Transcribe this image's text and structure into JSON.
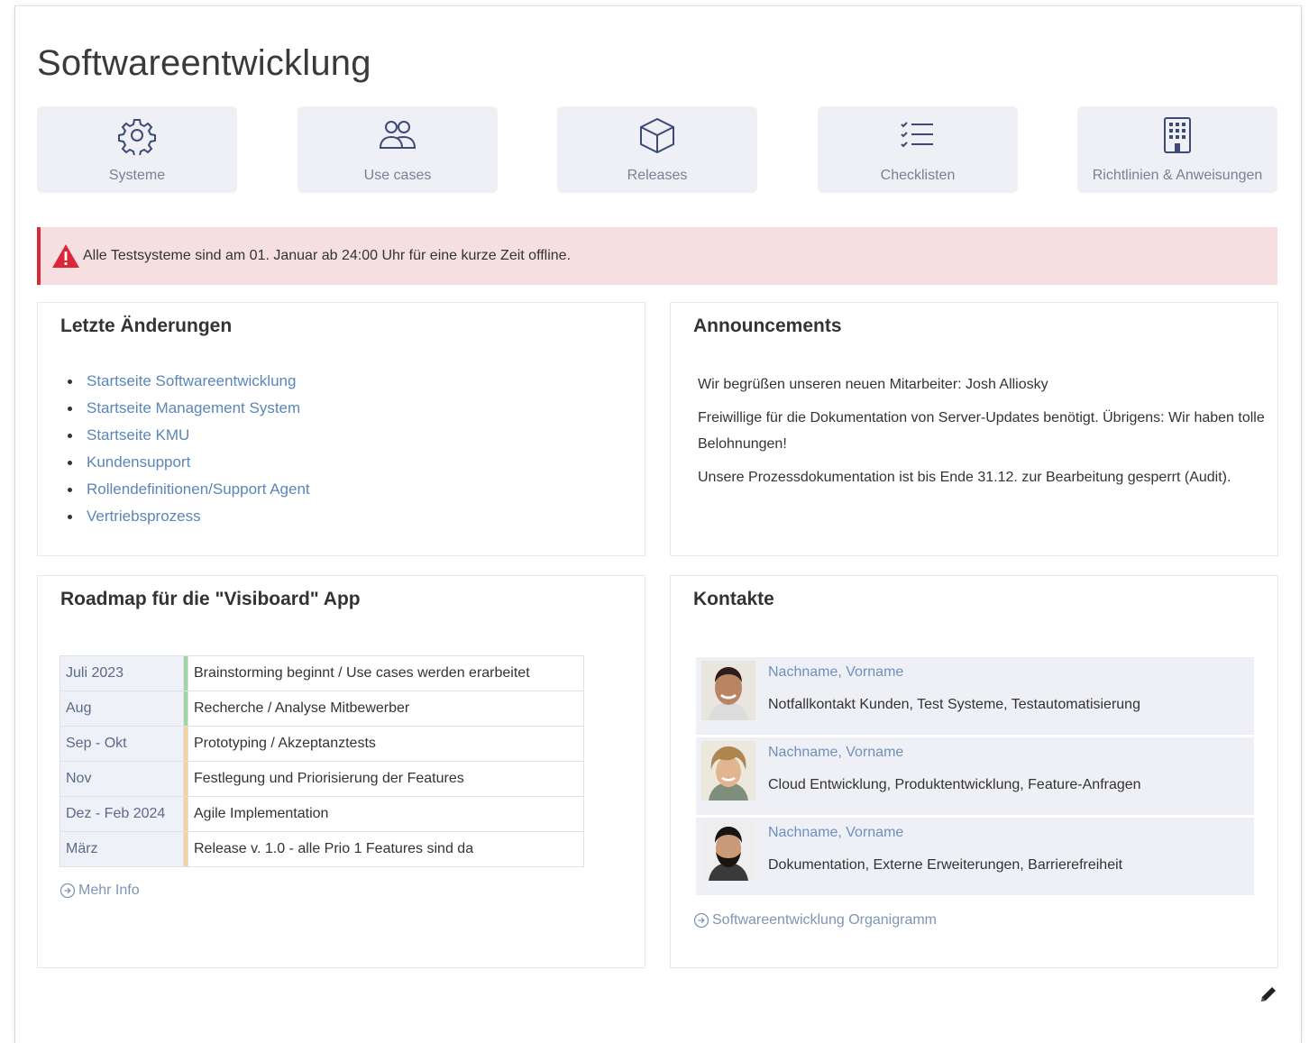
{
  "page": {
    "title": "Softwareentwicklung"
  },
  "tiles": [
    {
      "label": "Systeme",
      "icon": "gear-icon"
    },
    {
      "label": "Use cases",
      "icon": "users-icon"
    },
    {
      "label": "Releases",
      "icon": "cube-icon"
    },
    {
      "label": "Checklisten",
      "icon": "checklist-icon"
    },
    {
      "label": "Richtlinien & Anweisungen",
      "icon": "building-icon"
    }
  ],
  "alert": {
    "text": "Alle Testsysteme sind am 01. Januar ab 24:00 Uhr für eine kurze Zeit offline.",
    "color": "#d9283a"
  },
  "recent_changes": {
    "title": "Letzte Änderungen",
    "items": [
      "Startseite Softwareentwicklung",
      "Startseite Management System",
      "Startseite KMU",
      "Kundensupport",
      "Rollendefinitionen/Support Agent",
      "Vertriebsprozess"
    ]
  },
  "announcements": {
    "title": "Announcements",
    "items": [
      "Wir begrüßen unseren neuen Mitarbeiter: Josh Alliosky",
      "Freiwillige für die Dokumentation von Server-Updates benötigt. Übrigens: Wir haben tolle Belohnungen!",
      "Unsere Prozessdokumentation ist bis Ende 31.12. zur Bearbeitung gesperrt (Audit)."
    ]
  },
  "roadmap": {
    "title": "Roadmap für die \"Visiboard\" App",
    "rows": [
      {
        "period": "Juli 2023",
        "status_color": "#9ed5a4",
        "task": "Brainstorming beginnt / Use cases werden erarbeitet"
      },
      {
        "period": "Aug",
        "status_color": "#9ed5a4",
        "task": "Recherche / Analyse Mitbewerber"
      },
      {
        "period": "Sep - Okt",
        "status_color": "#f3d2a0",
        "task": "Prototyping / Akzeptanztests"
      },
      {
        "period": "Nov",
        "status_color": "#f3d2a0",
        "task": "Festlegung und Priorisierung der Features"
      },
      {
        "period": "Dez - Feb 2024",
        "status_color": "#f3d2a0",
        "task": "Agile Implementation"
      },
      {
        "period": "März",
        "status_color": "#f3d2a0",
        "task": "Release v. 1.0 - alle Prio 1 Features sind da"
      }
    ],
    "more_link": "Mehr Info"
  },
  "contacts": {
    "title": "Kontakte",
    "items": [
      {
        "name": "Nachname, Vorname",
        "role": "Notfallkontakt Kunden, Test Systeme, Testautomatisierung"
      },
      {
        "name": "Nachname, Vorname",
        "role": "Cloud Entwicklung, Produktentwicklung, Feature-Anfragen"
      },
      {
        "name": "Nachname, Vorname",
        "role": "Dokumentation, Externe Erweiterungen, Barrierefreiheit"
      }
    ],
    "more_link": "Softwareentwicklung Organigramm"
  },
  "colors": {
    "tile_bg": "#eef0f6",
    "link": "#5a86b8",
    "icon": "#3d4a78"
  }
}
